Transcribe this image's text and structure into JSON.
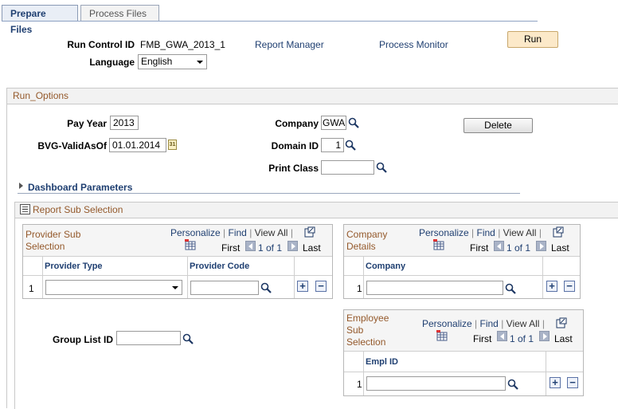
{
  "tabs": [
    {
      "label": "Prepare Files"
    },
    {
      "label": "Process Files"
    }
  ],
  "header": {
    "run_control_label": "Run Control ID",
    "run_control_value": "FMB_GWA_2013_1",
    "report_manager": "Report Manager",
    "process_monitor": "Process Monitor",
    "run_button": "Run",
    "language_label": "Language",
    "language_value": "English"
  },
  "run_options": {
    "title": "Run_Options",
    "pay_year_label": "Pay Year",
    "pay_year_value": "2013",
    "bvg_label": "BVG-ValidAsOf",
    "bvg_value": "01.01.2014",
    "calendar_icon_text": "31",
    "company_label": "Company",
    "company_value": "GWA",
    "domain_label": "Domain ID",
    "domain_value": "1",
    "print_class_label": "Print Class",
    "print_class_value": "",
    "delete_button": "Delete",
    "dashboard_label": "Dashboard Parameters"
  },
  "report_sub": {
    "title": "Report Sub Selection",
    "provider_grid": {
      "title_line1": "Provider Sub",
      "title_line2": "Selection",
      "personalize": "Personalize",
      "find": "Find",
      "view_all": "View All",
      "first": "First",
      "count": "1 of 1",
      "last": "Last",
      "col_type": "Provider Type",
      "col_code": "Provider Code",
      "row_num": "1",
      "type_value": "",
      "code_value": ""
    },
    "company_grid": {
      "title_line1": "Company",
      "title_line2": "Details",
      "personalize": "Personalize",
      "find": "Find",
      "view_all": "View All",
      "first": "First",
      "count": "1 of 1",
      "last": "Last",
      "col_company": "Company",
      "row_num": "1",
      "company_value": ""
    },
    "employee_grid": {
      "title_line1": "Employee",
      "title_line2": "Sub",
      "title_line3": "Selection",
      "personalize": "Personalize",
      "find": "Find",
      "view_all": "View All",
      "first": "First",
      "count": "1 of 1",
      "last": "Last",
      "col_emplid": "Empl ID",
      "row_num": "1",
      "emplid_value": ""
    },
    "group_list_label": "Group List ID",
    "group_list_value": ""
  },
  "symbols": {
    "sep": "|",
    "plus": "+",
    "minus": "−"
  },
  "colors": {
    "section_title": "#94592b",
    "link": "#1f3f71",
    "run_button": "#fce9c9"
  }
}
